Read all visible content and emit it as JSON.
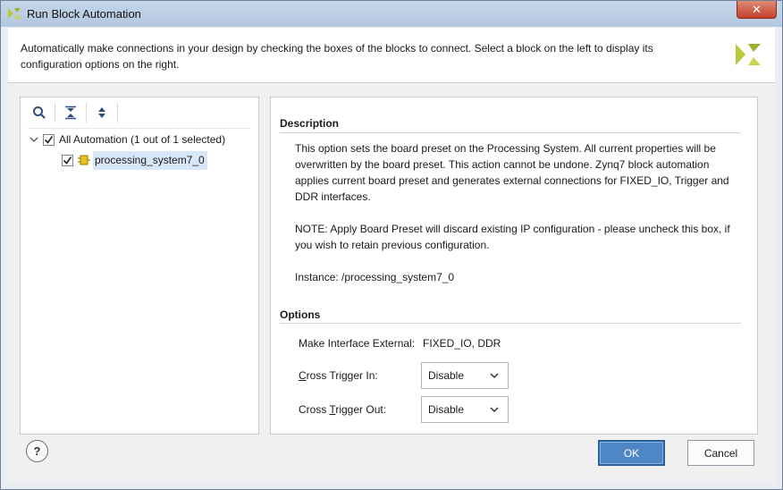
{
  "window": {
    "title": "Run Block Automation",
    "close_label": "✕"
  },
  "header": {
    "description": "Automatically make connections in your design by checking the boxes of the blocks to connect. Select a block on the left to display its configuration options on the right."
  },
  "tree": {
    "root_label": "All Automation (1 out of 1 selected)",
    "root_checked": true,
    "child_label": "processing_system7_0",
    "child_checked": true
  },
  "toolbar": {
    "icons": [
      "search-icon",
      "collapse-all-icon",
      "expand-all-icon"
    ]
  },
  "description": {
    "title": "Description",
    "para1": "This option sets the board preset on the Processing System. All current properties will be overwritten by the board preset. This action cannot be undone. Zynq7 block automation applies current board preset and generates external connections for FIXED_IO, Trigger and DDR interfaces.",
    "para2": "NOTE: Apply Board Preset will discard existing IP configuration - please uncheck this box, if you wish to retain previous configuration.",
    "instance": "Instance: /processing_system7_0"
  },
  "options": {
    "title": "Options",
    "make_external_label": "Make Interface External:",
    "make_external_value": "FIXED_IO, DDR",
    "cross_trigger_in_label_pre": "C",
    "cross_trigger_in_label_post": "ross Trigger In:",
    "cross_trigger_in_value": "Disable",
    "cross_trigger_out_label_pre": "Cross ",
    "cross_trigger_out_label_u": "T",
    "cross_trigger_out_label_post": "rigger Out:",
    "cross_trigger_out_value": "Disable"
  },
  "buttons": {
    "help": "?",
    "ok": "OK",
    "cancel": "Cancel"
  },
  "colors": {
    "accent": "#4f86c6",
    "logo": "#b8c93a",
    "ip_icon": "#e8c21a"
  }
}
